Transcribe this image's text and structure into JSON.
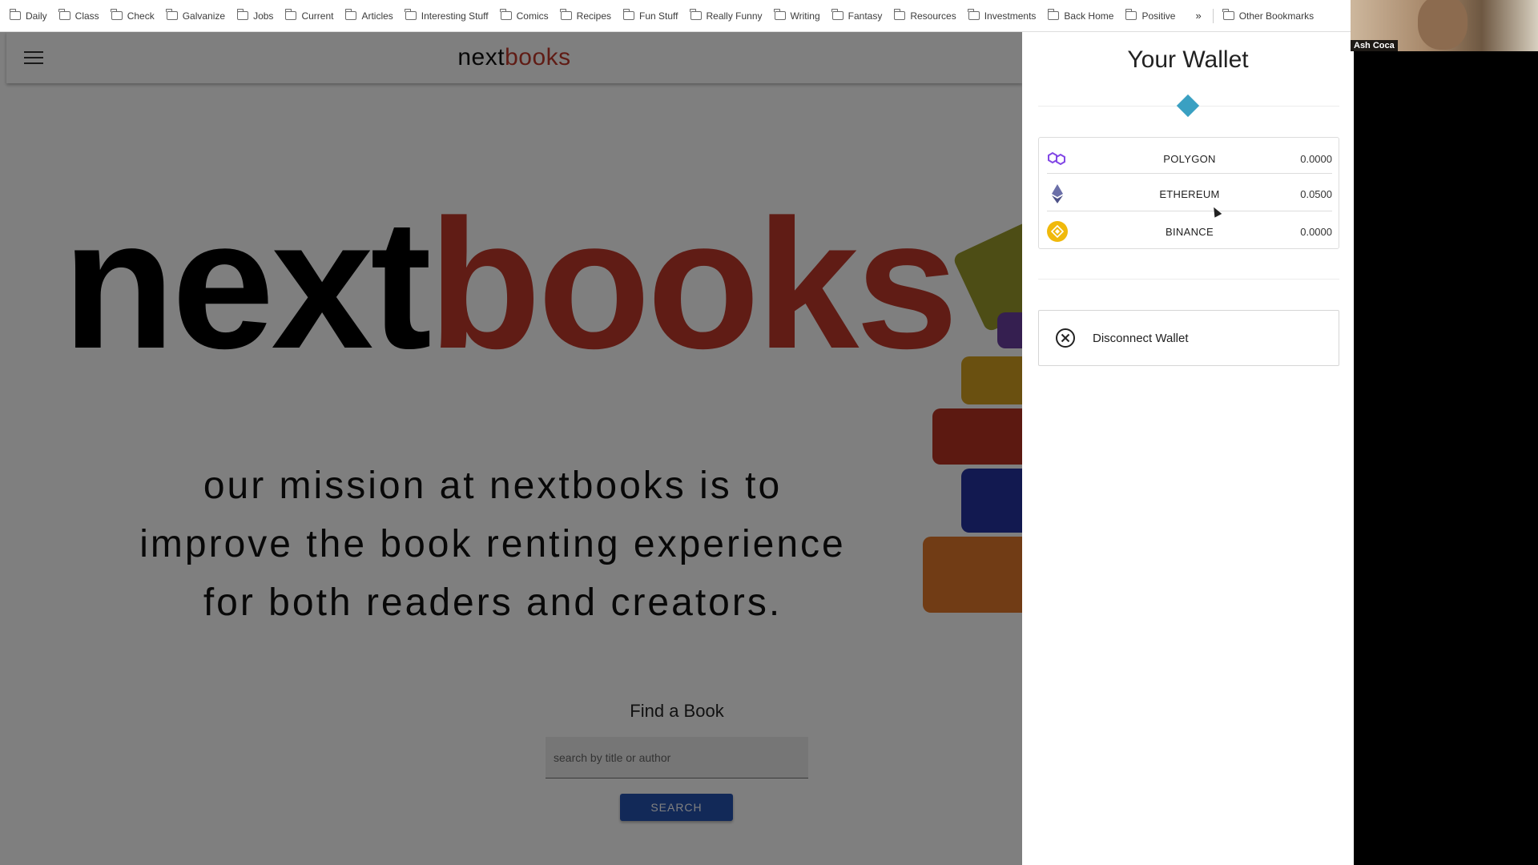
{
  "bookmarks": {
    "items": [
      "Daily",
      "Class",
      "Check",
      "Galvanize",
      "Jobs",
      "Current",
      "Articles",
      "Interesting Stuff",
      "Comics",
      "Recipes",
      "Fun Stuff",
      "Really Funny",
      "Writing",
      "Fantasy",
      "Resources",
      "Investments",
      "Back Home",
      "Positive"
    ],
    "more": "»",
    "other": "Other Bookmarks"
  },
  "webcam": {
    "name": "Ash Coca"
  },
  "appbar": {
    "brand_part1": "next",
    "brand_part2": "books",
    "menu_icon": "hamburger-menu-icon"
  },
  "hero": {
    "logo_part1": "next",
    "logo_part2": "books",
    "mission_line1": "our mission at nextbooks is to",
    "mission_line2": "improve the book renting experience",
    "mission_line3": "for both readers and creators."
  },
  "search": {
    "title": "Find a Book",
    "placeholder": "search by title or author",
    "button": "SEARCH"
  },
  "wallet": {
    "title": "Your Wallet",
    "balances": [
      {
        "name": "POLYGON",
        "amount": "0.0000",
        "icon": "polygon-icon"
      },
      {
        "name": "ETHEREUM",
        "amount": "0.0500",
        "icon": "ethereum-icon"
      },
      {
        "name": "BINANCE",
        "amount": "0.0000",
        "icon": "binance-icon"
      }
    ],
    "disconnect": "Disconnect Wallet"
  },
  "colors": {
    "brand_red": "#c0392b",
    "search_button": "#2553b0",
    "wallet_diamond": "#3aa0c2",
    "binance_gold": "#f0b90b",
    "polygon_purple": "#8247e5"
  }
}
